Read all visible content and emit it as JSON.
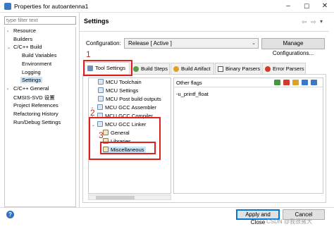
{
  "window": {
    "title": "Properties for autoantenna1",
    "min": "–",
    "max": "☐",
    "close": "✕"
  },
  "left": {
    "filter_placeholder": "type filter text",
    "items": [
      {
        "label": "Resource",
        "arrow": "›"
      },
      {
        "label": "Builders",
        "arrow": ""
      },
      {
        "label": "C/C++ Build",
        "arrow": "⌄"
      },
      {
        "label": "Build Variables",
        "arrow": ""
      },
      {
        "label": "Environment",
        "arrow": ""
      },
      {
        "label": "Logging",
        "arrow": ""
      },
      {
        "label": "Settings",
        "arrow": ""
      },
      {
        "label": "C/C++ General",
        "arrow": "›"
      },
      {
        "label": "CMSIS-SVD 设置",
        "arrow": ""
      },
      {
        "label": "Project References",
        "arrow": ""
      },
      {
        "label": "Refactoring History",
        "arrow": ""
      },
      {
        "label": "Run/Debug Settings",
        "arrow": ""
      }
    ]
  },
  "right": {
    "section_title": "Settings",
    "nav_back": "⇦",
    "nav_fwd": "⇨",
    "nav_menu": "▾",
    "config_label": "Configuration:",
    "config_value": "Release  [ Active ]",
    "config_dd": "⌄",
    "manage_button": "Manage Configurations...",
    "tabs": [
      {
        "label": "Tool Settings"
      },
      {
        "label": "Build Steps"
      },
      {
        "label": "Build Artifact"
      },
      {
        "label": "Binary Parsers"
      },
      {
        "label": "Error Parsers"
      }
    ],
    "tree": [
      {
        "label": "MCU Toolchain",
        "arrow": ""
      },
      {
        "label": "MCU Settings",
        "arrow": ""
      },
      {
        "label": "MCU Post build outputs",
        "arrow": ""
      },
      {
        "label": "MCU GCC Assembler",
        "arrow": "›"
      },
      {
        "label": "MCU GCC Compiler",
        "arrow": "›"
      },
      {
        "label": "MCU GCC Linker",
        "arrow": "⌄"
      },
      {
        "label": "General",
        "arrow": ""
      },
      {
        "label": "Libraries",
        "arrow": ""
      },
      {
        "label": "Miscellaneous",
        "arrow": ""
      }
    ],
    "flags_header": "Other flags",
    "flags_value": "-u_printf_float"
  },
  "annotations": [
    "1",
    "2",
    "3"
  ],
  "footer": {
    "help": "?",
    "apply_close": "Apply and Close",
    "cancel": "Cancel"
  },
  "watermark": "CSDN @我很猪大",
  "colors": {
    "highlight_red": "#e0201c",
    "selection_blue": "#cce4f7",
    "accent_blue": "#2f71c9"
  }
}
